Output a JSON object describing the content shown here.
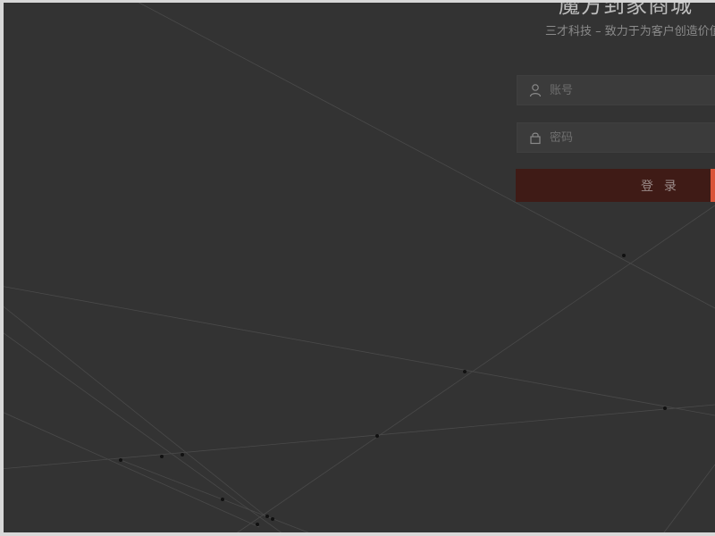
{
  "brand": {
    "title": "魔方到家商城",
    "subtitle": "三才科技 – 致力于为客户创造价值"
  },
  "login_form": {
    "account_placeholder": "账号",
    "password_placeholder": "密码",
    "submit_label": "登 录"
  },
  "icons": {
    "account": "user-icon",
    "password": "lock-icon"
  },
  "colors": {
    "background": "#333333",
    "button": "#3f1b16",
    "button_accent": "#d9553b"
  }
}
